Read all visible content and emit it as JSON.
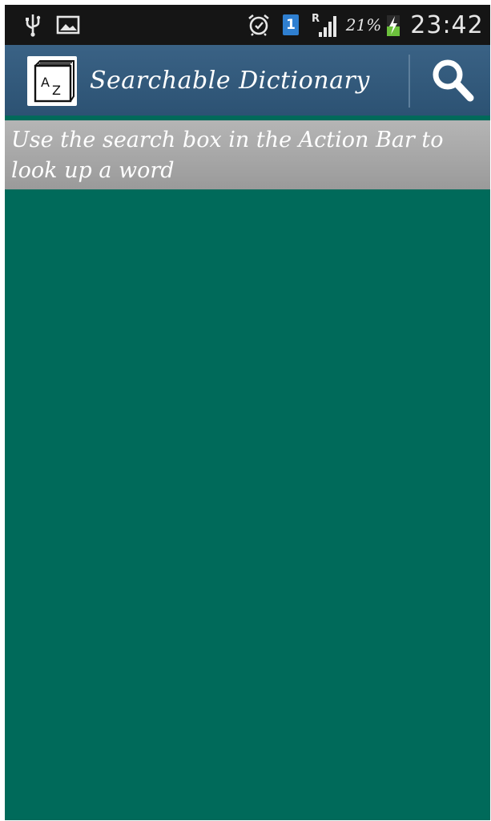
{
  "status_bar": {
    "usb_icon": "usb-icon",
    "gallery_icon": "image-icon",
    "alarm_icon": "alarm-clock-icon",
    "sim_badge": "1",
    "signal_roaming": "R",
    "battery_percent": "21%",
    "clock": "23:42"
  },
  "action_bar": {
    "app_icon_text_a": "A",
    "app_icon_text_z": "Z",
    "title": "Searchable Dictionary",
    "search_icon": "search-icon"
  },
  "hint": {
    "text": "Use the search box in the Action Bar to look up a word"
  },
  "colors": {
    "status_bar": "#151515",
    "action_bar": "#2c5273",
    "hint_bar": "#a8a8a8",
    "content": "#006a5a"
  }
}
